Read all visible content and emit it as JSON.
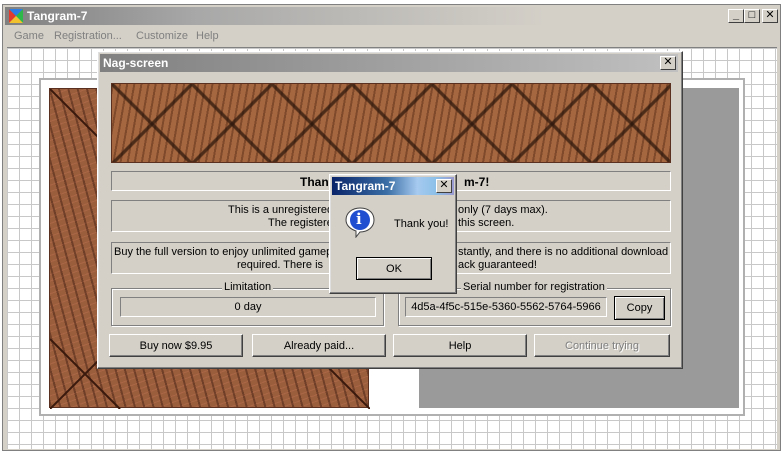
{
  "main_window": {
    "title": "Tangram-7",
    "controls": {
      "minimize": "_",
      "maximize": "□",
      "close": "✕"
    },
    "menu": [
      "Game",
      "Registration...",
      "Customize",
      "Help"
    ]
  },
  "nag": {
    "title": "Nag-screen",
    "close": "✕",
    "thanks_visible": "Than",
    "thanks_visible_tail": "m-7!",
    "info_left_1": "This is a unregistered",
    "info_right_1": "only  (7 days max).",
    "info_left_2": "The registere",
    "info_right_2": "this screen.",
    "buy_left_1": "Buy the full version to enjoy unlimited gamepl",
    "buy_right_1": "stantly, and there is no additional download",
    "buy_left_2": "required. There is",
    "buy_right_2": "ack guaranteed!",
    "limitation_label": "Limitation",
    "limitation_value": "0 day",
    "serial_label": "Serial number for registration",
    "serial_value": "4d5a-4f5c-515e-5360-5562-5764-5966",
    "copy_label": "Copy",
    "buttons": {
      "buy": "Buy now $9.95",
      "already_paid": "Already paid...",
      "help": "Help",
      "continue": "Continue trying"
    }
  },
  "msgbox": {
    "title": "Tangram-7",
    "close": "✕",
    "message": "Thank you!",
    "ok": "OK",
    "icon_glyph": "i"
  },
  "colors": {
    "titlebar_active": "#0a246a",
    "titlebar_inactive": "#808080",
    "face": "#d4d0c8",
    "board_gray": "#9a9a9a"
  }
}
